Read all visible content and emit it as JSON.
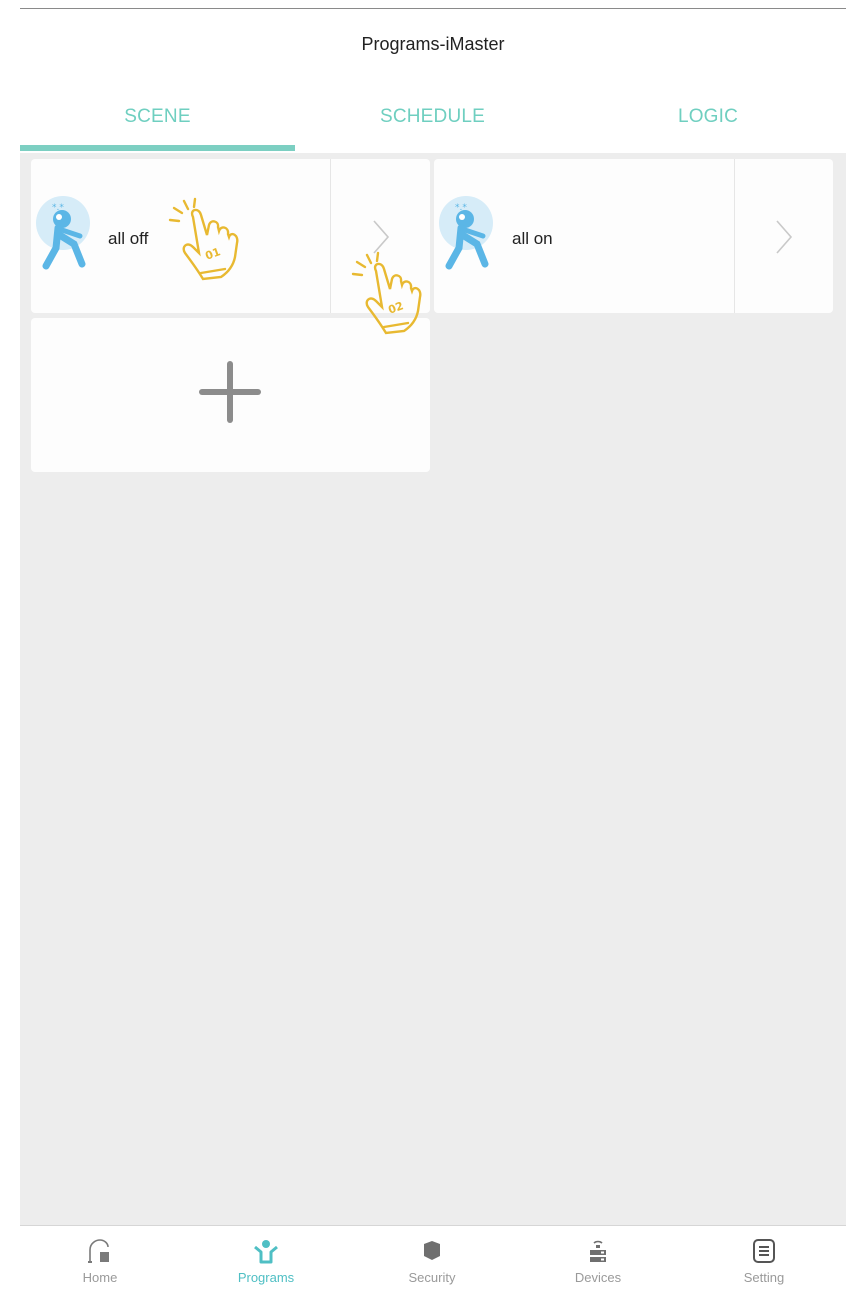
{
  "header": {
    "title": "Programs-iMaster"
  },
  "tabs": [
    {
      "label": "SCENE",
      "active": true
    },
    {
      "label": "SCHEDULE",
      "active": false
    },
    {
      "label": "LOGIC",
      "active": false
    }
  ],
  "scenes": [
    {
      "name": "all off",
      "icon": "sleeping-person-icon"
    },
    {
      "name": "all on",
      "icon": "sleeping-person-icon"
    }
  ],
  "add_scene": {
    "icon": "plus-icon"
  },
  "annotations": [
    {
      "label": "01"
    },
    {
      "label": "02"
    }
  ],
  "bottom_nav": [
    {
      "label": "Home",
      "icon": "home-icon",
      "active": false
    },
    {
      "label": "Programs",
      "icon": "programs-icon",
      "active": true
    },
    {
      "label": "Security",
      "icon": "shield-icon",
      "active": false
    },
    {
      "label": "Devices",
      "icon": "router-icon",
      "active": false
    },
    {
      "label": "Setting",
      "icon": "list-icon",
      "active": false
    }
  ],
  "colors": {
    "accent": "#7ccfc2",
    "tab_text": "#6fcfc0",
    "background": "#ededed",
    "annotation": "#e8b931",
    "avatar": "#5bb6e6"
  }
}
